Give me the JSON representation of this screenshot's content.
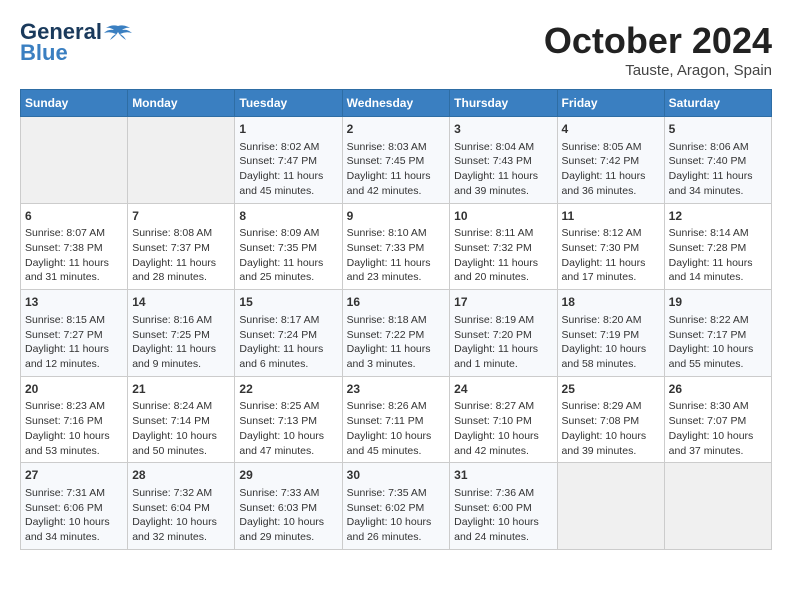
{
  "header": {
    "logo_line1": "General",
    "logo_line2": "Blue",
    "month": "October 2024",
    "location": "Tauste, Aragon, Spain"
  },
  "weekdays": [
    "Sunday",
    "Monday",
    "Tuesday",
    "Wednesday",
    "Thursday",
    "Friday",
    "Saturday"
  ],
  "weeks": [
    [
      {
        "day": "",
        "info": ""
      },
      {
        "day": "",
        "info": ""
      },
      {
        "day": "1",
        "info": "Sunrise: 8:02 AM\nSunset: 7:47 PM\nDaylight: 11 hours and 45 minutes."
      },
      {
        "day": "2",
        "info": "Sunrise: 8:03 AM\nSunset: 7:45 PM\nDaylight: 11 hours and 42 minutes."
      },
      {
        "day": "3",
        "info": "Sunrise: 8:04 AM\nSunset: 7:43 PM\nDaylight: 11 hours and 39 minutes."
      },
      {
        "day": "4",
        "info": "Sunrise: 8:05 AM\nSunset: 7:42 PM\nDaylight: 11 hours and 36 minutes."
      },
      {
        "day": "5",
        "info": "Sunrise: 8:06 AM\nSunset: 7:40 PM\nDaylight: 11 hours and 34 minutes."
      }
    ],
    [
      {
        "day": "6",
        "info": "Sunrise: 8:07 AM\nSunset: 7:38 PM\nDaylight: 11 hours and 31 minutes."
      },
      {
        "day": "7",
        "info": "Sunrise: 8:08 AM\nSunset: 7:37 PM\nDaylight: 11 hours and 28 minutes."
      },
      {
        "day": "8",
        "info": "Sunrise: 8:09 AM\nSunset: 7:35 PM\nDaylight: 11 hours and 25 minutes."
      },
      {
        "day": "9",
        "info": "Sunrise: 8:10 AM\nSunset: 7:33 PM\nDaylight: 11 hours and 23 minutes."
      },
      {
        "day": "10",
        "info": "Sunrise: 8:11 AM\nSunset: 7:32 PM\nDaylight: 11 hours and 20 minutes."
      },
      {
        "day": "11",
        "info": "Sunrise: 8:12 AM\nSunset: 7:30 PM\nDaylight: 11 hours and 17 minutes."
      },
      {
        "day": "12",
        "info": "Sunrise: 8:14 AM\nSunset: 7:28 PM\nDaylight: 11 hours and 14 minutes."
      }
    ],
    [
      {
        "day": "13",
        "info": "Sunrise: 8:15 AM\nSunset: 7:27 PM\nDaylight: 11 hours and 12 minutes."
      },
      {
        "day": "14",
        "info": "Sunrise: 8:16 AM\nSunset: 7:25 PM\nDaylight: 11 hours and 9 minutes."
      },
      {
        "day": "15",
        "info": "Sunrise: 8:17 AM\nSunset: 7:24 PM\nDaylight: 11 hours and 6 minutes."
      },
      {
        "day": "16",
        "info": "Sunrise: 8:18 AM\nSunset: 7:22 PM\nDaylight: 11 hours and 3 minutes."
      },
      {
        "day": "17",
        "info": "Sunrise: 8:19 AM\nSunset: 7:20 PM\nDaylight: 11 hours and 1 minute."
      },
      {
        "day": "18",
        "info": "Sunrise: 8:20 AM\nSunset: 7:19 PM\nDaylight: 10 hours and 58 minutes."
      },
      {
        "day": "19",
        "info": "Sunrise: 8:22 AM\nSunset: 7:17 PM\nDaylight: 10 hours and 55 minutes."
      }
    ],
    [
      {
        "day": "20",
        "info": "Sunrise: 8:23 AM\nSunset: 7:16 PM\nDaylight: 10 hours and 53 minutes."
      },
      {
        "day": "21",
        "info": "Sunrise: 8:24 AM\nSunset: 7:14 PM\nDaylight: 10 hours and 50 minutes."
      },
      {
        "day": "22",
        "info": "Sunrise: 8:25 AM\nSunset: 7:13 PM\nDaylight: 10 hours and 47 minutes."
      },
      {
        "day": "23",
        "info": "Sunrise: 8:26 AM\nSunset: 7:11 PM\nDaylight: 10 hours and 45 minutes."
      },
      {
        "day": "24",
        "info": "Sunrise: 8:27 AM\nSunset: 7:10 PM\nDaylight: 10 hours and 42 minutes."
      },
      {
        "day": "25",
        "info": "Sunrise: 8:29 AM\nSunset: 7:08 PM\nDaylight: 10 hours and 39 minutes."
      },
      {
        "day": "26",
        "info": "Sunrise: 8:30 AM\nSunset: 7:07 PM\nDaylight: 10 hours and 37 minutes."
      }
    ],
    [
      {
        "day": "27",
        "info": "Sunrise: 7:31 AM\nSunset: 6:06 PM\nDaylight: 10 hours and 34 minutes."
      },
      {
        "day": "28",
        "info": "Sunrise: 7:32 AM\nSunset: 6:04 PM\nDaylight: 10 hours and 32 minutes."
      },
      {
        "day": "29",
        "info": "Sunrise: 7:33 AM\nSunset: 6:03 PM\nDaylight: 10 hours and 29 minutes."
      },
      {
        "day": "30",
        "info": "Sunrise: 7:35 AM\nSunset: 6:02 PM\nDaylight: 10 hours and 26 minutes."
      },
      {
        "day": "31",
        "info": "Sunrise: 7:36 AM\nSunset: 6:00 PM\nDaylight: 10 hours and 24 minutes."
      },
      {
        "day": "",
        "info": ""
      },
      {
        "day": "",
        "info": ""
      }
    ]
  ]
}
